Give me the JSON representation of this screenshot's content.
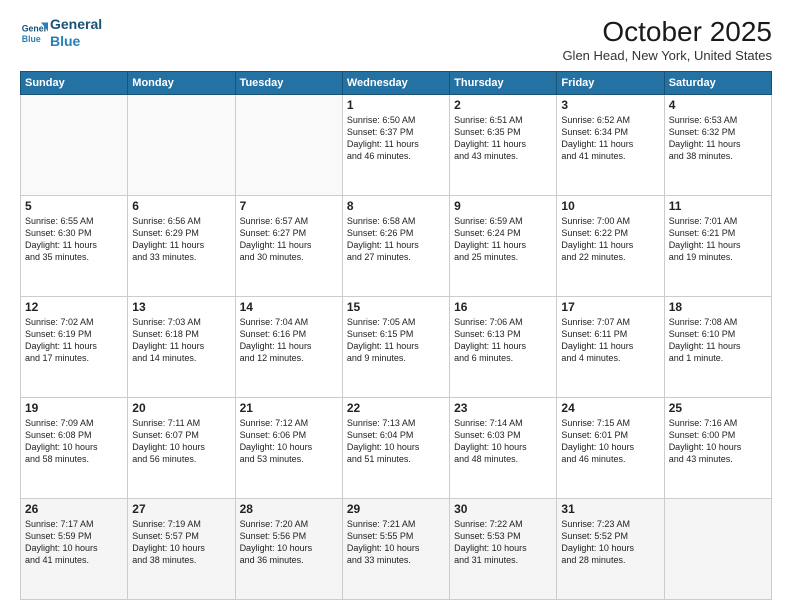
{
  "logo": {
    "line1": "General",
    "line2": "Blue"
  },
  "title": "October 2025",
  "location": "Glen Head, New York, United States",
  "headers": [
    "Sunday",
    "Monday",
    "Tuesday",
    "Wednesday",
    "Thursday",
    "Friday",
    "Saturday"
  ],
  "weeks": [
    [
      {
        "day": "",
        "text": ""
      },
      {
        "day": "",
        "text": ""
      },
      {
        "day": "",
        "text": ""
      },
      {
        "day": "1",
        "text": "Sunrise: 6:50 AM\nSunset: 6:37 PM\nDaylight: 11 hours\nand 46 minutes."
      },
      {
        "day": "2",
        "text": "Sunrise: 6:51 AM\nSunset: 6:35 PM\nDaylight: 11 hours\nand 43 minutes."
      },
      {
        "day": "3",
        "text": "Sunrise: 6:52 AM\nSunset: 6:34 PM\nDaylight: 11 hours\nand 41 minutes."
      },
      {
        "day": "4",
        "text": "Sunrise: 6:53 AM\nSunset: 6:32 PM\nDaylight: 11 hours\nand 38 minutes."
      }
    ],
    [
      {
        "day": "5",
        "text": "Sunrise: 6:55 AM\nSunset: 6:30 PM\nDaylight: 11 hours\nand 35 minutes."
      },
      {
        "day": "6",
        "text": "Sunrise: 6:56 AM\nSunset: 6:29 PM\nDaylight: 11 hours\nand 33 minutes."
      },
      {
        "day": "7",
        "text": "Sunrise: 6:57 AM\nSunset: 6:27 PM\nDaylight: 11 hours\nand 30 minutes."
      },
      {
        "day": "8",
        "text": "Sunrise: 6:58 AM\nSunset: 6:26 PM\nDaylight: 11 hours\nand 27 minutes."
      },
      {
        "day": "9",
        "text": "Sunrise: 6:59 AM\nSunset: 6:24 PM\nDaylight: 11 hours\nand 25 minutes."
      },
      {
        "day": "10",
        "text": "Sunrise: 7:00 AM\nSunset: 6:22 PM\nDaylight: 11 hours\nand 22 minutes."
      },
      {
        "day": "11",
        "text": "Sunrise: 7:01 AM\nSunset: 6:21 PM\nDaylight: 11 hours\nand 19 minutes."
      }
    ],
    [
      {
        "day": "12",
        "text": "Sunrise: 7:02 AM\nSunset: 6:19 PM\nDaylight: 11 hours\nand 17 minutes."
      },
      {
        "day": "13",
        "text": "Sunrise: 7:03 AM\nSunset: 6:18 PM\nDaylight: 11 hours\nand 14 minutes."
      },
      {
        "day": "14",
        "text": "Sunrise: 7:04 AM\nSunset: 6:16 PM\nDaylight: 11 hours\nand 12 minutes."
      },
      {
        "day": "15",
        "text": "Sunrise: 7:05 AM\nSunset: 6:15 PM\nDaylight: 11 hours\nand 9 minutes."
      },
      {
        "day": "16",
        "text": "Sunrise: 7:06 AM\nSunset: 6:13 PM\nDaylight: 11 hours\nand 6 minutes."
      },
      {
        "day": "17",
        "text": "Sunrise: 7:07 AM\nSunset: 6:11 PM\nDaylight: 11 hours\nand 4 minutes."
      },
      {
        "day": "18",
        "text": "Sunrise: 7:08 AM\nSunset: 6:10 PM\nDaylight: 11 hours\nand 1 minute."
      }
    ],
    [
      {
        "day": "19",
        "text": "Sunrise: 7:09 AM\nSunset: 6:08 PM\nDaylight: 10 hours\nand 58 minutes."
      },
      {
        "day": "20",
        "text": "Sunrise: 7:11 AM\nSunset: 6:07 PM\nDaylight: 10 hours\nand 56 minutes."
      },
      {
        "day": "21",
        "text": "Sunrise: 7:12 AM\nSunset: 6:06 PM\nDaylight: 10 hours\nand 53 minutes."
      },
      {
        "day": "22",
        "text": "Sunrise: 7:13 AM\nSunset: 6:04 PM\nDaylight: 10 hours\nand 51 minutes."
      },
      {
        "day": "23",
        "text": "Sunrise: 7:14 AM\nSunset: 6:03 PM\nDaylight: 10 hours\nand 48 minutes."
      },
      {
        "day": "24",
        "text": "Sunrise: 7:15 AM\nSunset: 6:01 PM\nDaylight: 10 hours\nand 46 minutes."
      },
      {
        "day": "25",
        "text": "Sunrise: 7:16 AM\nSunset: 6:00 PM\nDaylight: 10 hours\nand 43 minutes."
      }
    ],
    [
      {
        "day": "26",
        "text": "Sunrise: 7:17 AM\nSunset: 5:59 PM\nDaylight: 10 hours\nand 41 minutes."
      },
      {
        "day": "27",
        "text": "Sunrise: 7:19 AM\nSunset: 5:57 PM\nDaylight: 10 hours\nand 38 minutes."
      },
      {
        "day": "28",
        "text": "Sunrise: 7:20 AM\nSunset: 5:56 PM\nDaylight: 10 hours\nand 36 minutes."
      },
      {
        "day": "29",
        "text": "Sunrise: 7:21 AM\nSunset: 5:55 PM\nDaylight: 10 hours\nand 33 minutes."
      },
      {
        "day": "30",
        "text": "Sunrise: 7:22 AM\nSunset: 5:53 PM\nDaylight: 10 hours\nand 31 minutes."
      },
      {
        "day": "31",
        "text": "Sunrise: 7:23 AM\nSunset: 5:52 PM\nDaylight: 10 hours\nand 28 minutes."
      },
      {
        "day": "",
        "text": ""
      }
    ]
  ]
}
